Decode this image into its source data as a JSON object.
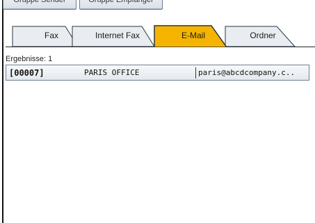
{
  "top_buttons": [
    {
      "label": "Gruppe Sender"
    },
    {
      "label": "Gruppe Empfänger"
    }
  ],
  "tabs": [
    {
      "label": "Fax",
      "selected": false
    },
    {
      "label": "Internet Fax",
      "selected": false
    },
    {
      "label": "E-Mail",
      "selected": true
    },
    {
      "label": "Ordner",
      "selected": false
    }
  ],
  "results": {
    "label": "Ergebnisse: 1"
  },
  "rows": [
    {
      "id": "[00007]",
      "name": "PARIS OFFICE",
      "email": "paris@abcdcompany.c.."
    }
  ],
  "colors": {
    "selected_tab": "#f4b400",
    "tab_fill": "#e9edf1",
    "row_border": "#6f7f90"
  }
}
